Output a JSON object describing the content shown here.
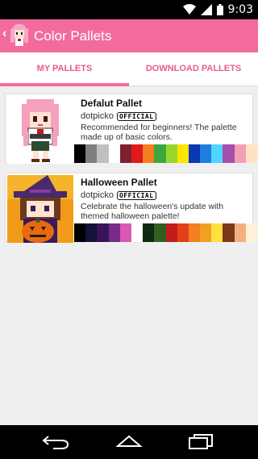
{
  "status_bar": {
    "time": "9:03"
  },
  "app_bar": {
    "title": "Color Pallets"
  },
  "tabs": [
    {
      "label": "MY PALLETS",
      "selected": true
    },
    {
      "label": "DOWNLOAD PALLETS",
      "selected": false
    }
  ],
  "pallets": [
    {
      "title": "Defalut Pallet",
      "author": "dotpicko",
      "badge": "OFFICIAL",
      "description": "Recommended for beginners! The palette made up of basic colors.",
      "colors": [
        "#000000",
        "#7f7f7f",
        "#c0c0c0",
        "#ffffff",
        "#7f1f2f",
        "#e01a1a",
        "#f57e20",
        "#3fa63f",
        "#9ad62a",
        "#ffe500",
        "#0d36b5",
        "#1f7de0",
        "#4fd6ff",
        "#a24fb0",
        "#f2a0b4",
        "#ffe2c4"
      ]
    },
    {
      "title": "Halloween Pallet",
      "author": "dotpicko",
      "badge": "OFFICIAL",
      "description": "Celebrate the halloween's update with themed halloween palette!",
      "colors": [
        "#000000",
        "#12123a",
        "#3a1456",
        "#7a2a8a",
        "#d85ab0",
        "#ffffff",
        "#0f2a0f",
        "#2f6020",
        "#c21c1c",
        "#e0401a",
        "#f57e20",
        "#f2a020",
        "#ffe040",
        "#7a3a1a",
        "#f2b080",
        "#fff0d8"
      ]
    }
  ],
  "colors": {
    "accent": "#f26b9c",
    "tab_text": "#e85a8f",
    "background": "#efefef"
  }
}
